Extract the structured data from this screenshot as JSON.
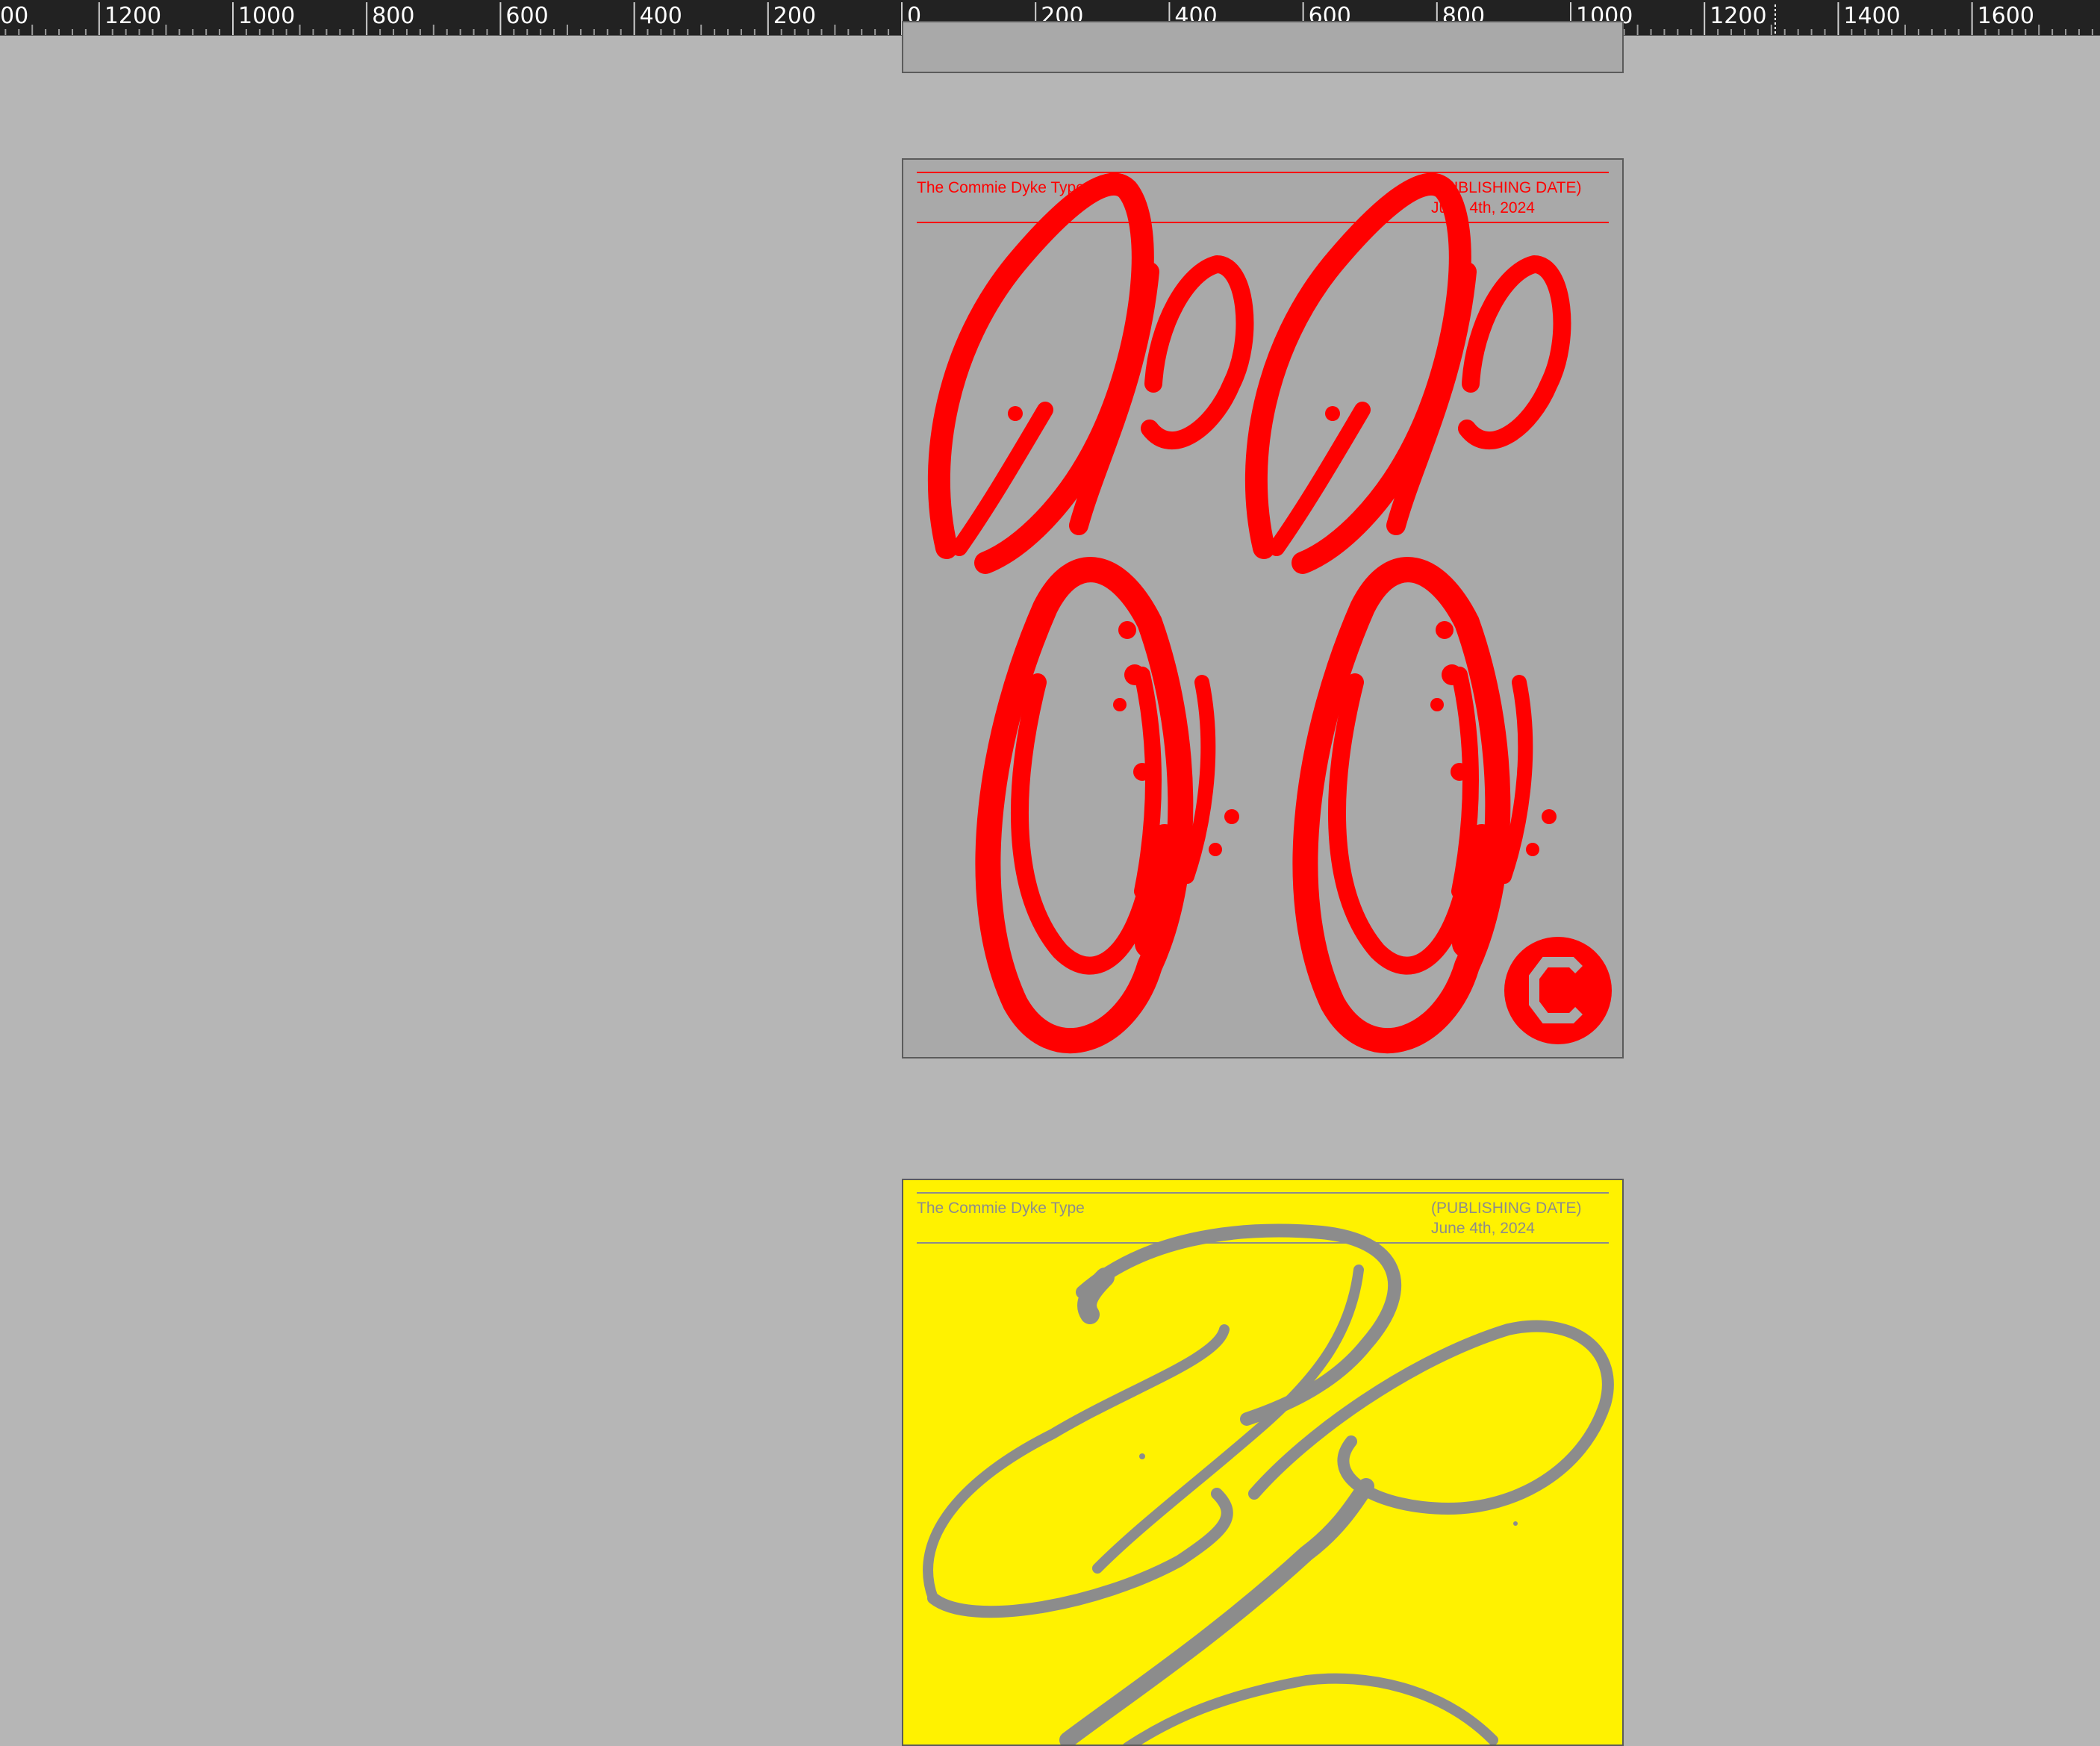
{
  "ruler": {
    "labels": [
      "00",
      "1200",
      "1000",
      "800",
      "600",
      "400",
      "200",
      "0",
      "200",
      "400",
      "600",
      "800",
      "1000",
      "1200",
      "1400",
      "1600"
    ]
  },
  "pages": [
    {
      "id": "poster-red",
      "title": "The Commie Dyke Type",
      "date_label": "(PUBLISHING DATE)",
      "date": "June 4th, 2024",
      "background": "#a9a9a9",
      "ink": "#ff0000",
      "mark": "copyright-icon"
    },
    {
      "id": "poster-yellow",
      "title": "The Commie Dyke Type",
      "date_label": "(PUBLISHING DATE)",
      "date": "June 4th, 2024",
      "background": "#fff200",
      "ink": "#8c8c8c"
    }
  ],
  "colors": {
    "workspace": "#b6b6b6",
    "ruler": "#222222",
    "ruler_text": "#ffffff"
  }
}
